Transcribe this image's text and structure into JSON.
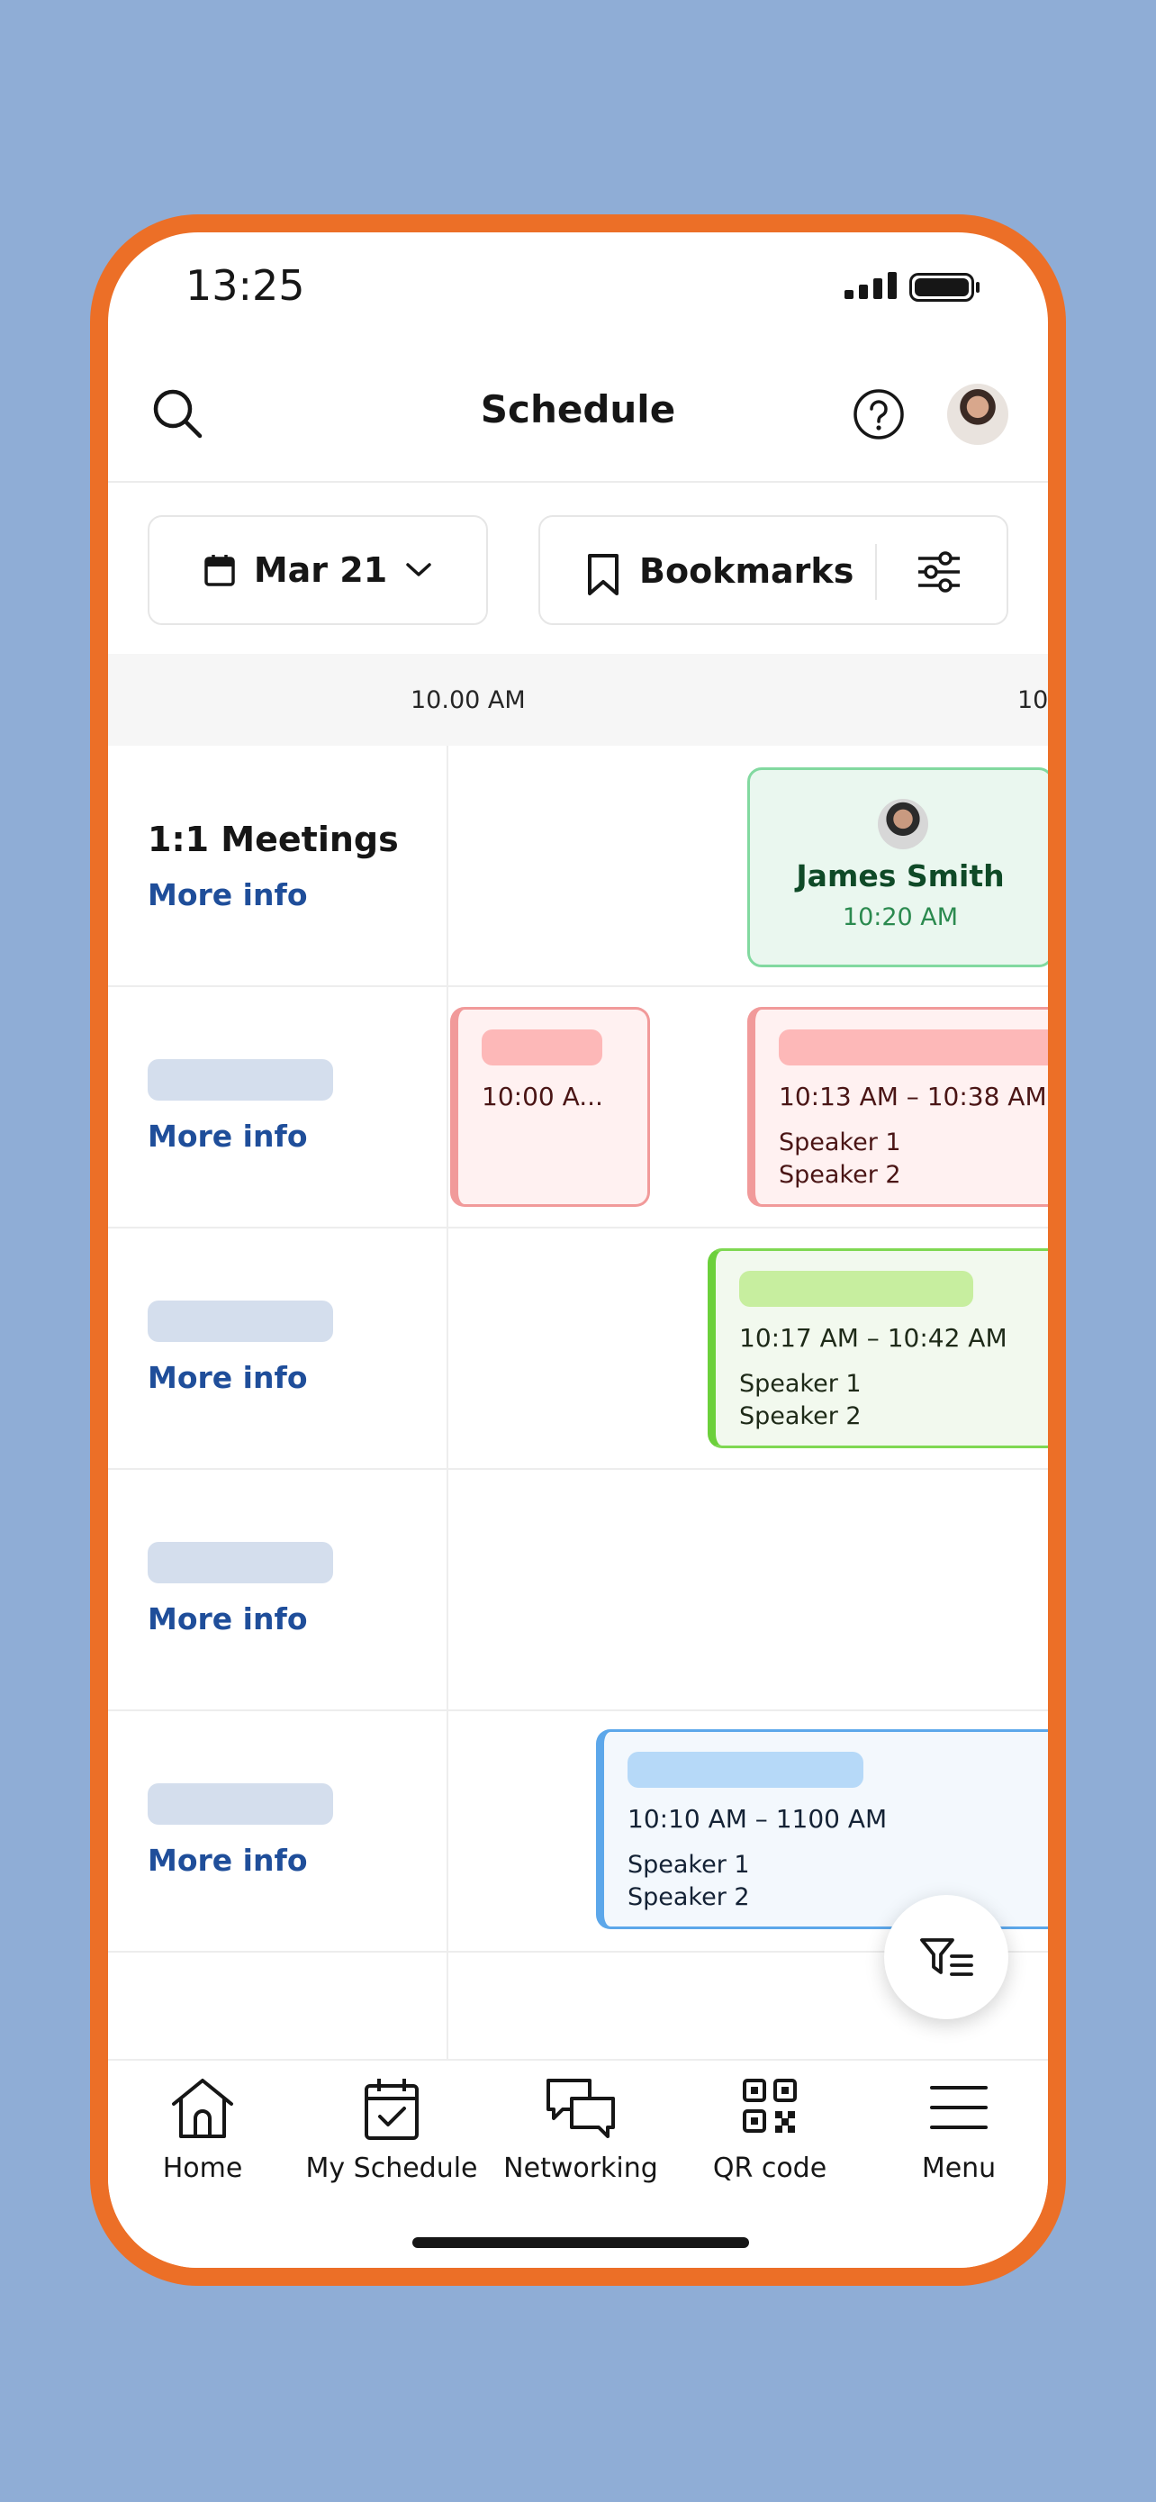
{
  "status_bar": {
    "time": "13:25"
  },
  "header": {
    "title": "Schedule"
  },
  "filters": {
    "date_label": "Mar 21",
    "bookmarks_label": "Bookmarks"
  },
  "timeline": {
    "time_label_1": "10.00 AM",
    "time_label_2_partial": "10"
  },
  "rows": [
    {
      "title": "1:1 Meetings",
      "more_info": "More info"
    },
    {
      "title": "",
      "more_info": "More info"
    },
    {
      "title": "",
      "more_info": "More info"
    },
    {
      "title": "",
      "more_info": "More info"
    },
    {
      "title": "",
      "more_info": "More info"
    }
  ],
  "events": {
    "meeting": {
      "name": "James Smith",
      "time": "10:20 AM"
    },
    "pink_small": {
      "time": "10:00 A..."
    },
    "pink_large": {
      "time": "10:13 AM – 10:38 AM",
      "speaker_1": "Speaker 1",
      "speaker_2": "Speaker 2"
    },
    "green": {
      "time": "10:17 AM – 10:42 AM",
      "speaker_1": "Speaker 1",
      "speaker_2": "Speaker 2"
    },
    "blue": {
      "time": "10:10 AM – 1100 AM",
      "speaker_1": "Speaker 1",
      "speaker_2": "Speaker 2"
    }
  },
  "bottom_nav": [
    {
      "label": "Home",
      "icon": "home-icon"
    },
    {
      "label": "My Schedule",
      "icon": "calendar-check-icon"
    },
    {
      "label": "Networking",
      "icon": "chat-bubbles-icon"
    },
    {
      "label": "QR code",
      "icon": "qr-code-icon"
    },
    {
      "label": "Menu",
      "icon": "menu-icon"
    }
  ],
  "colors": {
    "background": "#8fadd6",
    "frame": "#ec6f27",
    "link": "#1f4e9a",
    "pink_accent": "#f19a9a",
    "green_accent": "#6cd03b",
    "blue_accent": "#5ca7ea",
    "meeting_green": "#82d9a0"
  }
}
